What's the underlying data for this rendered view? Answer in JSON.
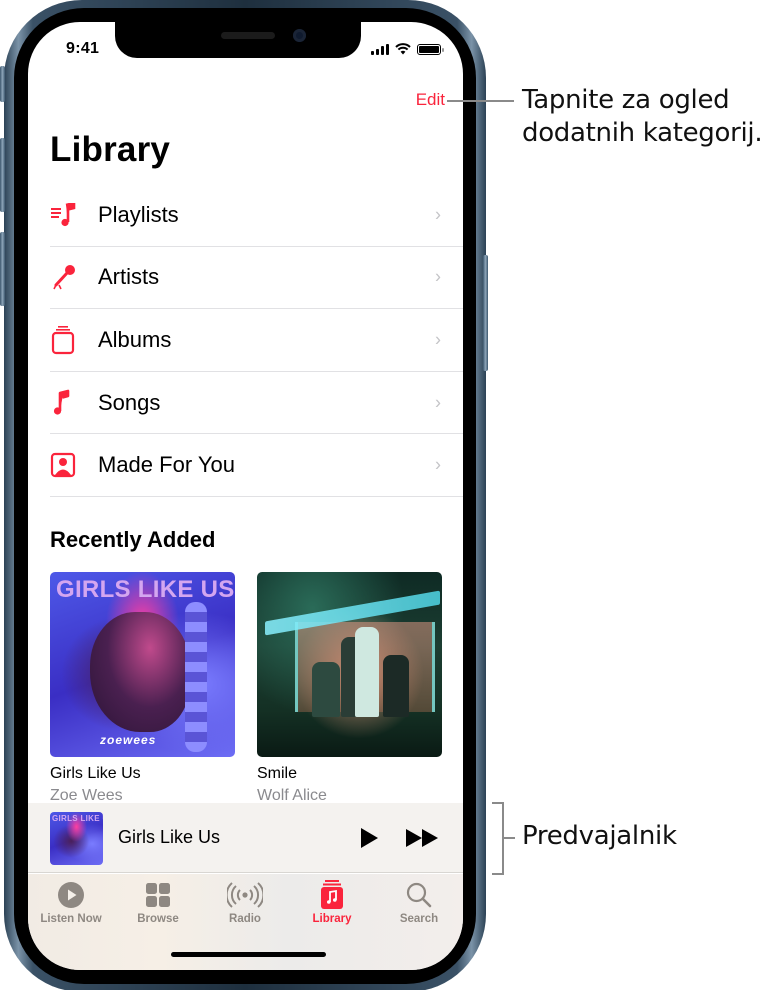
{
  "status_bar": {
    "time": "9:41",
    "icons": [
      "cellular-signal-icon",
      "wifi-icon",
      "battery-icon"
    ]
  },
  "header": {
    "edit_label": "Edit",
    "title": "Library"
  },
  "library_items": [
    {
      "label": "Playlists",
      "icon": "playlists-icon"
    },
    {
      "label": "Artists",
      "icon": "microphone-icon"
    },
    {
      "label": "Albums",
      "icon": "albums-stack-icon"
    },
    {
      "label": "Songs",
      "icon": "music-note-icon"
    },
    {
      "label": "Made For You",
      "icon": "person-square-icon"
    }
  ],
  "recently_added": {
    "title": "Recently Added",
    "albums": [
      {
        "title": "Girls Like Us",
        "artist": "Zoe Wees",
        "cover_text": "GIRLS LIKE US",
        "cover_logo": "zoewees"
      },
      {
        "title": "Smile",
        "artist": "Wolf Alice"
      }
    ]
  },
  "mini_player": {
    "title": "Girls Like Us",
    "cover_text": "GIRLS LIKE US",
    "controls": [
      "play-icon",
      "fast-forward-icon"
    ]
  },
  "tab_bar": {
    "tabs": [
      {
        "label": "Listen Now",
        "icon": "play-circle-icon",
        "active": false
      },
      {
        "label": "Browse",
        "icon": "grid-icon",
        "active": false
      },
      {
        "label": "Radio",
        "icon": "radio-waves-icon",
        "active": false
      },
      {
        "label": "Library",
        "icon": "library-icon",
        "active": true
      },
      {
        "label": "Search",
        "icon": "search-icon",
        "active": false
      }
    ]
  },
  "callouts": {
    "edit": "Tapnite za ogled dodatnih kategorij.",
    "edit_line1": "Tapnite za ogled",
    "edit_line2": "dodatnih kategorij.",
    "player": "Predvajalnik"
  },
  "colors": {
    "accent": "#fa243c",
    "chevron": "#c4c4c7",
    "secondary_text": "#8a8a8e",
    "tab_inactive": "#8e8882"
  }
}
